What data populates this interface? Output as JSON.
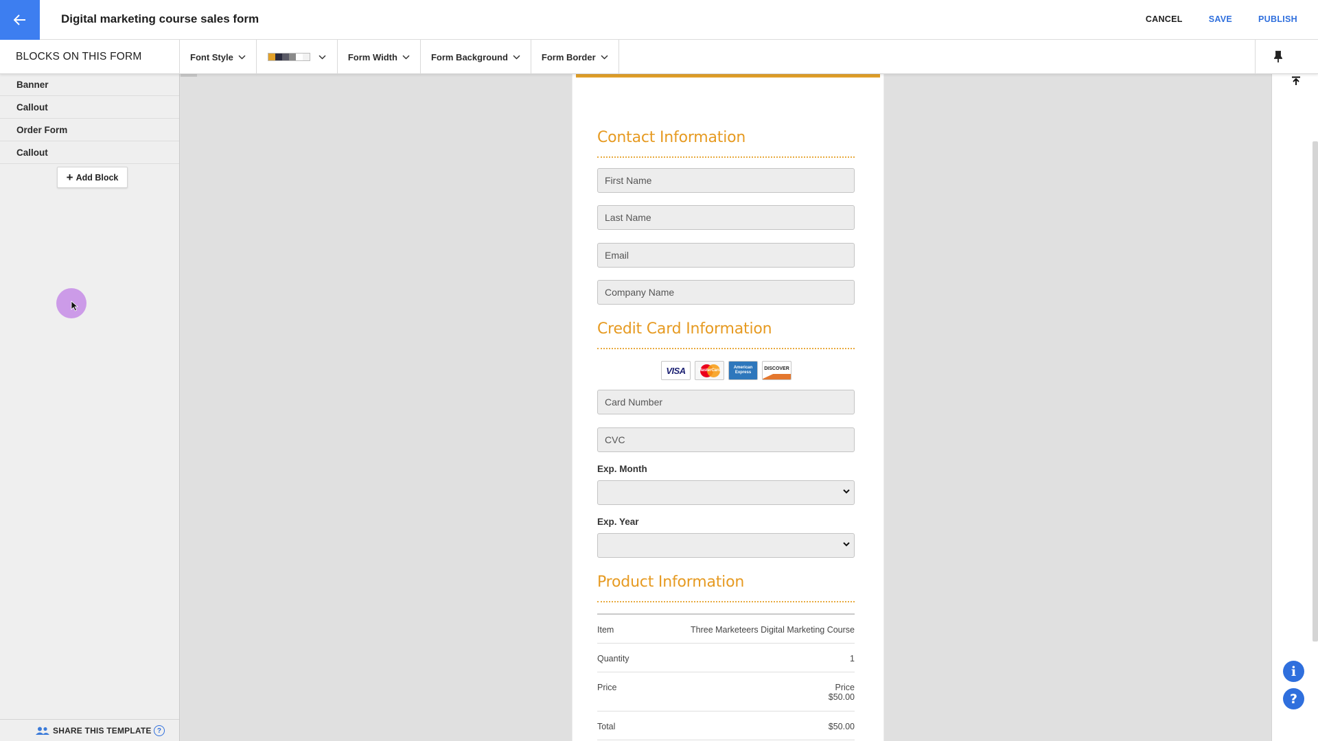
{
  "header": {
    "title": "Digital marketing course sales form",
    "actions": {
      "cancel": "CANCEL",
      "save": "SAVE",
      "publish": "PUBLISH"
    }
  },
  "toolbar": {
    "blocks_heading": "BLOCKS ON THIS FORM",
    "font_style": "Font Style",
    "form_width": "Form Width",
    "form_background": "Form Background",
    "form_border": "Form Border",
    "palette_colors": [
      "#e2a12a",
      "#2a2b3f",
      "#5a5a66",
      "#8a8a8a",
      "#ffffff",
      "#f2f2f2"
    ]
  },
  "sidebar": {
    "blocks": [
      "Banner",
      "Callout",
      "Order Form",
      "Callout"
    ],
    "add_block": "Add Block",
    "share": "SHARE THIS TEMPLATE",
    "share_help": "?"
  },
  "form": {
    "accent_color": "#e2a12a",
    "contact_title": "Contact Information",
    "first_name_placeholder": "First Name",
    "last_name_placeholder": "Last Name",
    "email_placeholder": "Email",
    "company_placeholder": "Company Name",
    "credit_title": "Credit Card Information",
    "cards": [
      "VISA",
      "MasterCard",
      "American Express",
      "DISCOVER"
    ],
    "card_number_placeholder": "Card Number",
    "cvc_placeholder": "CVC",
    "exp_month_label": "Exp. Month",
    "exp_year_label": "Exp. Year",
    "product_title": "Product Information",
    "product": {
      "item_label": "Item",
      "item_value": "Three Marketeers Digital Marketing Course",
      "quantity_label": "Quantity",
      "quantity_value": "1",
      "price_label": "Price",
      "price_value_label": "Price",
      "price_value": "$50.00",
      "total_label": "Total",
      "total_value": "$50.00"
    }
  }
}
